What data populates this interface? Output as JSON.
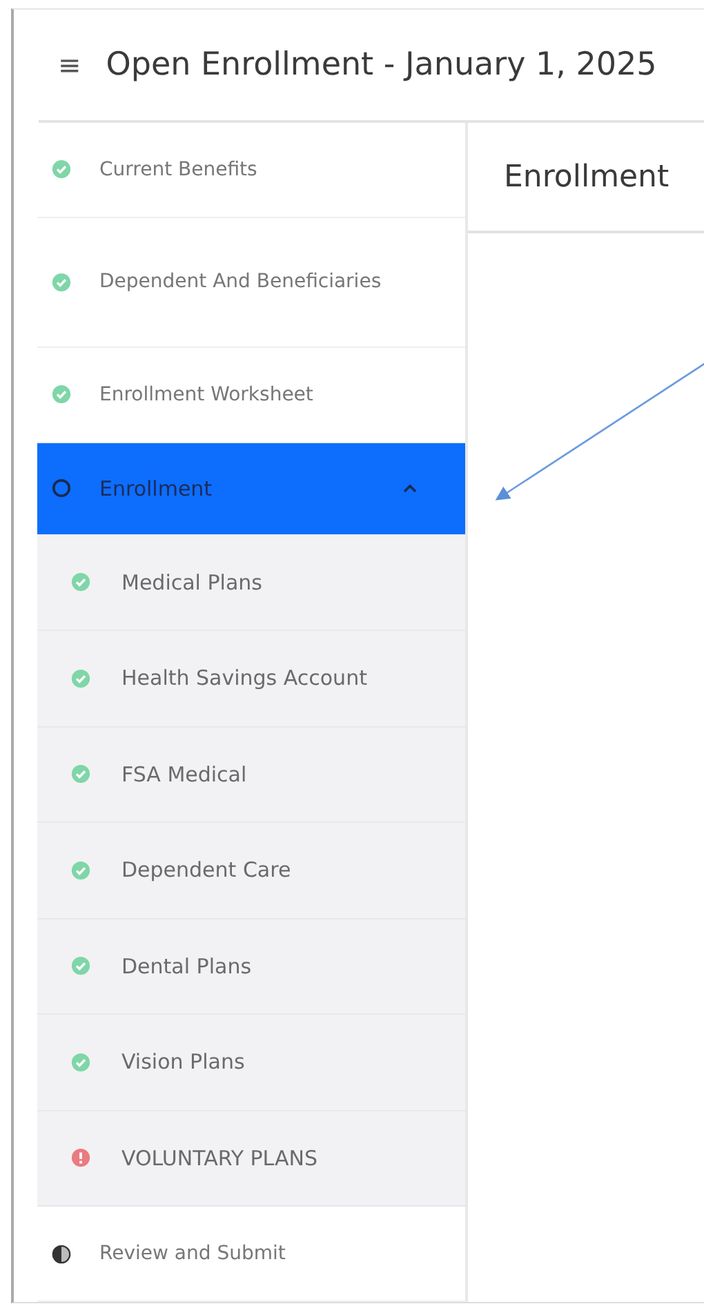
{
  "header": {
    "menu_icon": "≡",
    "title": "Open Enrollment - January 1, 2025"
  },
  "sidebar": {
    "items": [
      {
        "label": "Current Benefits",
        "kind": "complete",
        "selected": false
      },
      {
        "label": "Dependent And Beneficiaries",
        "kind": "complete",
        "selected": false
      },
      {
        "label": "Enrollment Worksheet",
        "kind": "complete",
        "selected": false
      },
      {
        "label": "Enrollment",
        "kind": "pending",
        "selected": true,
        "expanded": true,
        "children": [
          {
            "label": "Medical Plans",
            "kind": "complete",
            "selected": false
          },
          {
            "label": "Health Savings Account",
            "kind": "complete",
            "selected": false
          },
          {
            "label": "FSA Medical",
            "kind": "complete",
            "selected": false
          },
          {
            "label": "Dependent Care",
            "kind": "complete",
            "selected": false
          },
          {
            "label": "Dental Plans",
            "kind": "complete",
            "selected": false
          },
          {
            "label": "Vision Plans",
            "kind": "complete",
            "selected": false
          },
          {
            "label": "VOLUNTARY PLANS",
            "kind": "error",
            "selected": false
          }
        ]
      },
      {
        "label": "Review and Submit",
        "kind": "partial",
        "selected": false
      }
    ]
  },
  "content": {
    "title": "Enrollment"
  }
}
